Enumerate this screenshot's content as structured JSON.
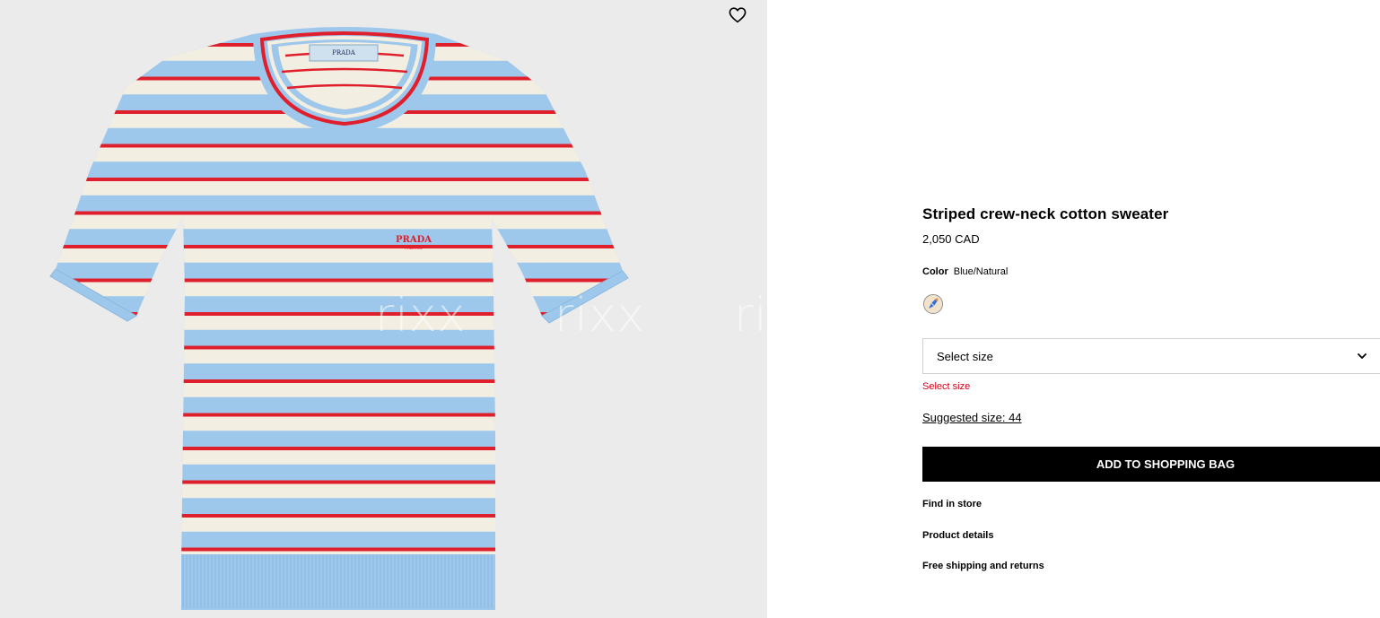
{
  "gallery": {
    "watermark_text": "rixx",
    "image_alt": "Striped crew-neck cotton sweater",
    "logo_text": "PRADA",
    "logo_subtext": "MILANO",
    "colors": {
      "blue": "#9dc8ec",
      "cream": "#f3eee2",
      "red": "#e01f2c",
      "background": "#ebebeb"
    }
  },
  "wishlist": {
    "icon": "heart-outline-icon"
  },
  "product": {
    "title": "Striped crew-neck cotton sweater",
    "price": "2,050 CAD",
    "color_label": "Color",
    "color_value": "Blue/Natural",
    "swatch_icon": "color-swatch-icon",
    "size_select": {
      "placeholder": "Select size",
      "icon": "chevron-down-icon"
    },
    "size_error": "Select size",
    "suggested_size": "Suggested size: 44",
    "add_to_bag": "ADD TO SHOPPING BAG",
    "links": [
      "Find in store",
      "Product details",
      "Free shipping and returns"
    ]
  },
  "colors": {
    "error": "#d0021b",
    "button_bg": "#000000",
    "button_text": "#ffffff"
  }
}
